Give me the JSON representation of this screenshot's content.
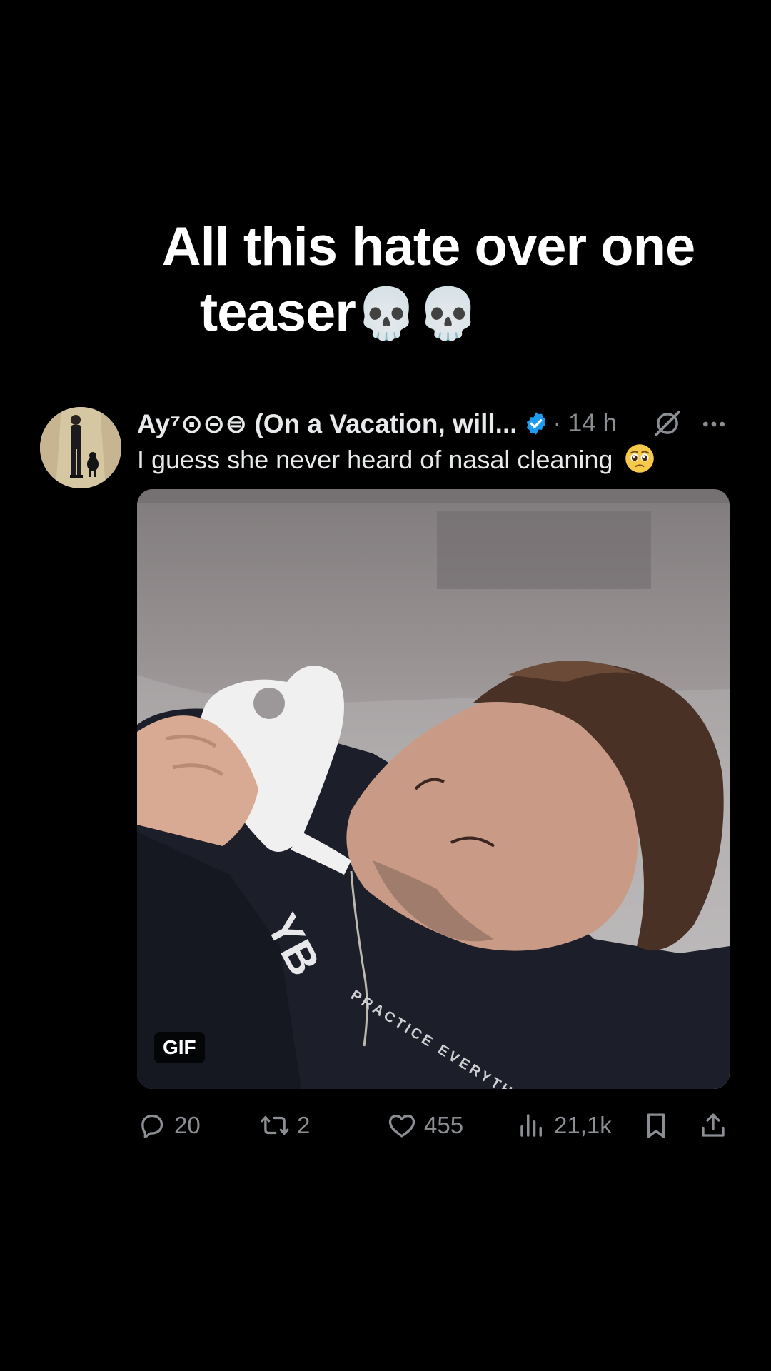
{
  "caption": {
    "line1": "All this hate over one",
    "line2": "teaser",
    "emoji": "💀💀"
  },
  "tweet": {
    "avatar_icon": "user-avatar-photo",
    "display_name": "Ay⁷⊙⊝⊜ (On a Vacation, will...",
    "verified_icon": "verified-badge-icon",
    "timestamp": "· 14 h",
    "grok_icon": "grok-icon",
    "more_icon": "more-options-icon",
    "text": "I guess she never heard of nasal cleaning",
    "text_emoji": "pleading-face-emoji",
    "media": {
      "type": "GIF",
      "badge": "GIF",
      "shirt_text": "YB",
      "shirt_subtext": "PRACTICE EVERYTH"
    },
    "actions": {
      "reply_count": "20",
      "repost_count": "2",
      "like_count": "455",
      "view_count": "21,1k",
      "bookmark_icon": "bookmark-icon",
      "share_icon": "share-icon"
    }
  },
  "colors": {
    "background": "#000000",
    "text_primary": "#e7e9ea",
    "text_secondary": "#8b8f94",
    "verified_blue": "#1d9bf0"
  }
}
